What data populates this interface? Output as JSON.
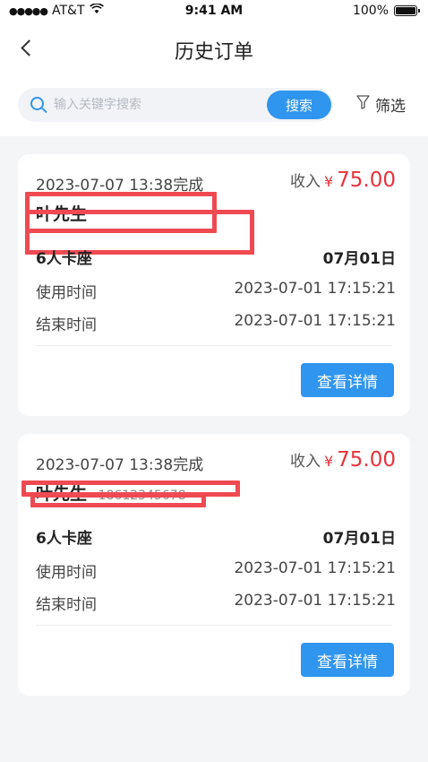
{
  "status_bar": {
    "carrier": "AT&T",
    "time": "9:41 AM",
    "battery": "100%"
  },
  "header": {
    "title": "历史订单"
  },
  "search": {
    "placeholder": "输入关键字搜索",
    "button_label": "搜索",
    "filter_label": "筛选"
  },
  "colors": {
    "accent": "#2f95ee",
    "price": "#e8333b",
    "redaction": "#ef4a52"
  },
  "orders": [
    {
      "completed_time": "2023-07-07 13:38完成",
      "income_label": "收入",
      "currency": "¥",
      "amount": "75.00",
      "customer": "叶先生",
      "phone": "",
      "room": "6人卡座",
      "date_month": "07",
      "date_month_unit": "月",
      "date_day": "01",
      "date_day_unit": "日",
      "use_time_label": "使用时间",
      "use_time": "2023-07-01 17:15:21",
      "end_time_label": "结束时间",
      "end_time": "2023-07-01 17:15:21",
      "detail_button": "查看详情"
    },
    {
      "completed_time": "2023-07-07 13:38完成",
      "income_label": "收入",
      "currency": "¥",
      "amount": "75.00",
      "customer": "叶先生",
      "phone": "18612345678",
      "room": "6人卡座",
      "date_month": "07",
      "date_month_unit": "月",
      "date_day": "01",
      "date_day_unit": "日",
      "use_time_label": "使用时间",
      "use_time": "2023-07-01 17:15:21",
      "end_time_label": "结束时间",
      "end_time": "2023-07-01 17:15:21",
      "detail_button": "查看详情"
    }
  ]
}
